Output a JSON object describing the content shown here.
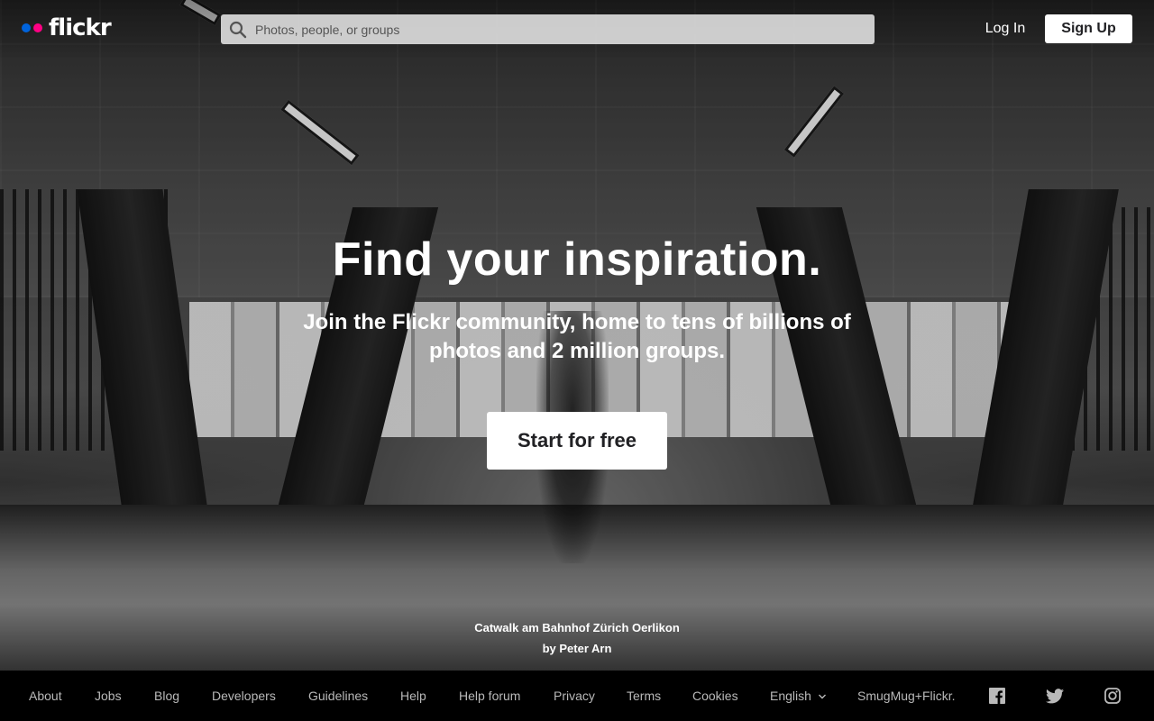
{
  "header": {
    "logo_text": "flickr",
    "search_placeholder": "Photos, people, or groups",
    "login_label": "Log In",
    "signup_label": "Sign Up"
  },
  "hero": {
    "headline": "Find your inspiration.",
    "subline": "Join the Flickr community, home to tens of billions of photos and 2 million groups.",
    "cta_label": "Start for free",
    "photo_title": "Catwalk am Bahnhof Zürich Oerlikon",
    "photo_author": "by Peter Arn"
  },
  "footer": {
    "links": [
      "About",
      "Jobs",
      "Blog",
      "Developers",
      "Guidelines",
      "Help",
      "Help forum",
      "Privacy",
      "Terms",
      "Cookies",
      "English",
      "SmugMug+Flickr."
    ],
    "language_chevron": "chevron-down-icon",
    "social_icons": [
      "facebook-icon",
      "twitter-icon",
      "instagram-icon"
    ]
  },
  "colors": {
    "brand_blue": "#0063dc",
    "brand_pink": "#ff0084",
    "footer_bg": "#000000",
    "footer_text": "#b9b9b9"
  }
}
